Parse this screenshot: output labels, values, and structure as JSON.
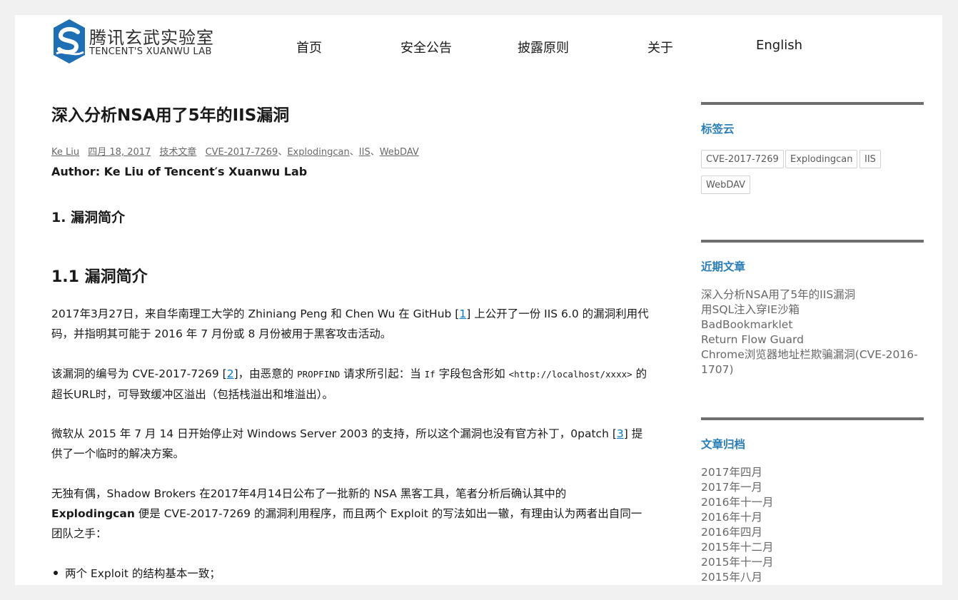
{
  "header": {
    "logo_cn": "腾讯玄武实验室",
    "logo_en": "TENCENT'S XUANWU LAB",
    "nav": [
      {
        "label": "首页"
      },
      {
        "label": "安全公告"
      },
      {
        "label": "披露原则"
      },
      {
        "label": "关于"
      },
      {
        "label": "English"
      }
    ]
  },
  "post": {
    "title": "深入分析NSA用了5年的IIS漏洞",
    "meta": {
      "author": "Ke Liu",
      "date": "四月 18, 2017",
      "category": "技术文章",
      "tags": [
        "CVE-2017-7269",
        "Explodingcan",
        "IIS",
        "WebDAV"
      ],
      "separator": "、"
    },
    "author_line": "Author: Ke Liu of Tencent′s Xuanwu Lab",
    "h1": "1. 漏洞简介",
    "h2": "1.1 漏洞简介",
    "p1": {
      "a": "2017年3月27日，来自华南理工大学的 Zhiniang Peng 和 Chen Wu 在 GitHub [",
      "link": "1",
      "b": "] 上公开了一份 IIS 6.0 的漏洞利用代码，并指明其可能于 2016 年 7 月份或 8 月份被用于黑客攻击活动。"
    },
    "p2": {
      "a": "该漏洞的编号为 CVE-2017-7269 [",
      "link": "2",
      "b": "]，由恶意的 ",
      "code1": "PROPFIND",
      "c": " 请求所引起：当 ",
      "code2": "If",
      "d": " 字段包含形如 ",
      "code3": "<http://localhost/xxxx>",
      "e": " 的超长URL时，可导致缓冲区溢出（包括栈溢出和堆溢出）。"
    },
    "p3": {
      "a": "微软从 2015 年 7 月 14 日开始停止对 Windows Server 2003 的支持，所以这个漏洞也没有官方补丁，0patch [",
      "link": "3",
      "b": "] 提供了一个临时的解决方案。"
    },
    "p4": {
      "a": "无独有偶，Shadow Brokers 在2017年4月14日公布了一批新的 NSA 黑客工具，笔者分析后确认其中的 ",
      "bold": "Explodingcan",
      "b": " 便是 CVE-2017-7269 的漏洞利用程序，而且两个 Exploit 的写法如出一辙，有理由认为两者出自同一团队之手："
    },
    "bullet1": "两个 Exploit 的结构基本一致；"
  },
  "sidebar": {
    "tagcloud": {
      "title": "标签云",
      "tags": [
        "CVE-2017-7269",
        "Explodingcan",
        "IIS",
        "WebDAV"
      ]
    },
    "recent": {
      "title": "近期文章",
      "items": [
        "深入分析NSA用了5年的IIS漏洞",
        "用SQL注入穿IE沙箱",
        "BadBookmarklet",
        "Return Flow Guard",
        "Chrome浏览器地址栏欺骗漏洞(CVE-2016-1707)"
      ]
    },
    "archive": {
      "title": "文章归档",
      "items": [
        "2017年四月",
        "2017年一月",
        "2016年十一月",
        "2016年十月",
        "2016年四月",
        "2015年十二月",
        "2015年十一月",
        "2015年八月"
      ]
    }
  },
  "colors": {
    "accent": "#2a7eb8",
    "link": "#007acc",
    "logo_blue": "#1f6fb5",
    "rule": "#6e6e6e"
  },
  "icons": [
    "xuanwu-logo-icon"
  ]
}
